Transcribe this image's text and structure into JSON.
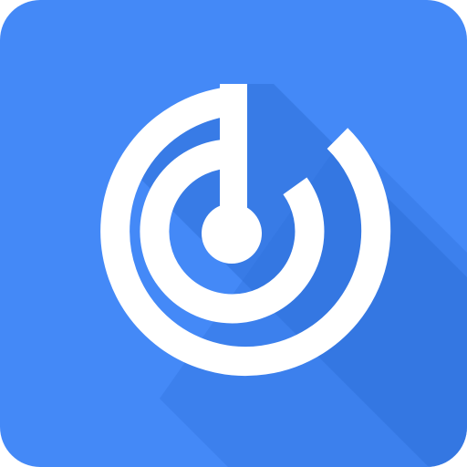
{
  "app_icon": {
    "name": "radar-target-icon",
    "colors": {
      "background": "#4489f7",
      "shadow": "#2f6fd9",
      "foreground": "#ffffff"
    }
  }
}
